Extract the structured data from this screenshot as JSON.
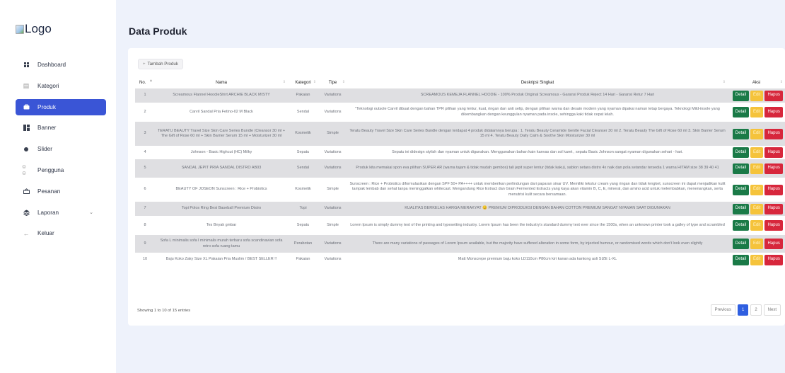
{
  "logo": {
    "text": "Logo"
  },
  "sidebar": {
    "items": [
      {
        "label": "Dashboard",
        "icon": "dashboard-grid-icon",
        "active": false
      },
      {
        "label": "Kategori",
        "icon": "kategori-icon",
        "active": false
      },
      {
        "label": "Produk",
        "icon": "produk-bag-icon",
        "active": true
      },
      {
        "label": "Banner",
        "icon": "banner-grid-icon",
        "active": false
      },
      {
        "label": "Slider",
        "icon": "slider-dot-icon",
        "active": false
      },
      {
        "label": "Pengguna",
        "icon": "users-icon",
        "active": false
      },
      {
        "label": "Pesanan",
        "icon": "orders-icon",
        "active": false
      },
      {
        "label": "Laporan",
        "icon": "report-layers-icon",
        "active": false
      },
      {
        "label": "Keluar",
        "icon": "logout-icon",
        "active": false
      }
    ]
  },
  "page": {
    "title": "Data Produk"
  },
  "toolbar": {
    "add_label": "Tambah Produk",
    "add_icon": "+"
  },
  "table": {
    "headers": [
      "No.",
      "Nama",
      "Kategori",
      "Tipe",
      "Deskripsi Singkat",
      "Aksi"
    ],
    "rows": [
      {
        "no": "1",
        "nama": "Screamous Flannel HoodieShirt ARCHIE BLACK MISTY",
        "kategori": "Pakaian",
        "tipe": "Variations",
        "deskripsi": "SCREAMOUS KEMEJA FLANNEL HOODIE - 100% Produk Original Screamous - Garansi Produk Reject 14 Hari - Garansi Retur 7 Hari"
      },
      {
        "no": "2",
        "nama": "Carvil Sandal Pria Fetino-02 M Black",
        "kategori": "Sendal",
        "tipe": "Variations",
        "deskripsi": "\"Teknologi outsole Carvil dibuat dengan bahan TPR pilihan yang lentur, kuat, ringan dan anti selip, dengan pilihan warna dan desain modern yang nyaman dipakai namun tetap bergaya. Teknologi Mild-insole yang dikembangkan dengan keunggulan nyaman pada insole, sehingga kaki tidak cepat lelah."
      },
      {
        "no": "3",
        "nama": "TERATU BEAUTY Travel Size Skin Care Series Bundle (Cleansor 30 ml + The Gift of Rose 60 ml + Skin Barrier Serum 15 ml + Moisturizer 30 ml",
        "kategori": "Kosmetik",
        "tipe": "Simple",
        "deskripsi": "Teratu Beauty Travel Size Skin Care Series Bundle dengan terdapat 4 produk didalamnya berupa : 1. Teratu Beauty Ceramide Gentle Facial Cleanser 30 ml 2. Teratu Beauty The Gift of Rose 60 ml 3. Skin Barrier Serum 15 ml 4. Teratu Beauty Daily Calm & Soothe Skin Moisturizer 30 ml"
      },
      {
        "no": "4",
        "nama": "Johnson - Basic Highcut (HC) Milky",
        "kategori": "Sepatu",
        "tipe": "Variations",
        "deskripsi": "Sepatu ini didesign stylish dan nyaman untuk digunakan. Menggunakan bahan kain kanvas dan sol karet , sepatu Basic Johnson sangat nyaman digunakan sehari - hari."
      },
      {
        "no": "5",
        "nama": "SANDAL JEPIT PRIA SANDAL DISTRO AB03",
        "kategori": "Sendal",
        "tipe": "Variations",
        "deskripsi": "Produk kita memakai spon eva pilihan SUPER AR (warna tajam & tidak mudah gembos) tali jepit super lentur (tidak kaku), sablon setara distro 4x naik dan pola setandar tersedia 1 warna HITAM size 38 39 40 41"
      },
      {
        "no": "6",
        "nama": "BEAUTY OF JOSEON Sunscreen : Rice + Probiotics",
        "kategori": "Kosmetik",
        "tipe": "Simple",
        "deskripsi": "Sunscreen : Rice + Probiotics diformulasikan dengan SPF 50+ PA++++ untuk memberikan perlindungan dari paparan sinar UV. Memiliki tekstur cream yang ringan dan tidak lengket, sunscreen ini dapat menjadikan kulit tampak lembab dan sehat tanpa meninggalkan whitecast. Mengandung Rice Extract dan Grain Fermented Extracts yang kaya akan vitamin B, C, E, mineral, dan amino acid untuk melembabkan, menenangkan, serta menutrisi kulit secara bersamaan."
      },
      {
        "no": "7",
        "nama": "Topi Polos Ring Besi Baseball Premium Distro",
        "kategori": "Topi",
        "tipe": "Variations",
        "deskripsi": "KUALITAS BERKELAS HARGA MERAKYAT 😊 PREMIUM DIPRODUKSI DENGAN BAHAN COTTON PREMIUM SANGAT NYAMAN SAAT DIGUNAKAN"
      },
      {
        "no": "8",
        "nama": "Tes Bnyak gmbar",
        "kategori": "Sepatu",
        "tipe": "Simple",
        "deskripsi": "Lorem Ipsum is simply dummy text of the printing and typesetting industry. Lorem Ipsum has been the industry's standard dummy text ever since the 1500s, when an unknown printer took a galley of type and scrambled"
      },
      {
        "no": "9",
        "nama": "Sofa L minimalis sofa l minimalis murah terbaru sofa scandinavian sofa retro sofa ruang tamu",
        "kategori": "Perabotan",
        "tipe": "Variations",
        "deskripsi": "There are many variations of passages of Lorem Ipsum available, but the majority have suffered alteration in some form, by injected humour, or randomised words which don't look even slightly"
      },
      {
        "no": "10",
        "nama": "Baju Koko Zaky Size XL Pakaian Pria Muslim / BEST SELLER !!",
        "kategori": "Pakaian",
        "tipe": "Variations",
        "deskripsi": "Matt Monscrepe premium baju koko LD110cm P80cm kiri kanan ada kantong asli SIZE L-XL"
      }
    ],
    "action_labels": {
      "detail": "Detail",
      "edit": "Edit",
      "hapus": "Hapus"
    }
  },
  "footer": {
    "info": "Showing 1 to 10 of 15 entries",
    "pagination": {
      "previous": "Previous",
      "pages": [
        "1",
        "2"
      ],
      "next": "Next",
      "current": "1"
    }
  },
  "colors": {
    "primary": "#3a55d6",
    "detail": "#1a7a47",
    "edit": "#f5c33b",
    "hapus": "#d7273c",
    "background": "#eef2fb"
  }
}
